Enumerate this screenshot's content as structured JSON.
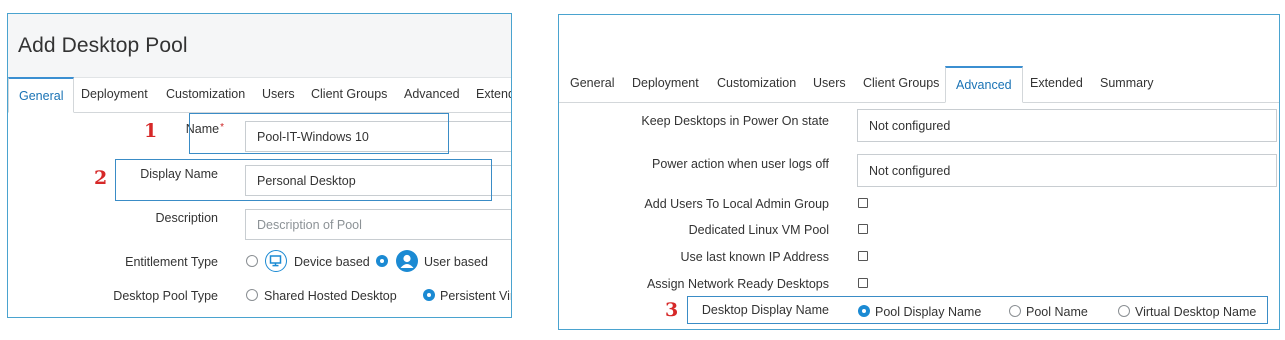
{
  "left": {
    "title": "Add Desktop Pool",
    "tabs": [
      "General",
      "Deployment",
      "Customization",
      "Users",
      "Client Groups",
      "Advanced",
      "Extend"
    ],
    "active_tab": "General",
    "name": {
      "label": "Name",
      "required_mark": "*",
      "value": "Pool-IT-Windows 10"
    },
    "display_name": {
      "label": "Display Name",
      "value": "Personal Desktop"
    },
    "description": {
      "label": "Description",
      "placeholder": "Description of Pool"
    },
    "entitlement": {
      "label": "Entitlement Type",
      "options": [
        "Device based",
        "User based"
      ],
      "selected": "User based"
    },
    "pool_type": {
      "label": "Desktop Pool Type",
      "options": [
        "Shared Hosted Desktop",
        "Persistent Virt"
      ],
      "selected": "Persistent Virt"
    }
  },
  "right": {
    "tabs": [
      "General",
      "Deployment",
      "Customization",
      "Users",
      "Client Groups",
      "Advanced",
      "Extended",
      "Summary"
    ],
    "active_tab": "Advanced",
    "keep_power_on": {
      "label": "Keep Desktops in Power On state",
      "value": "Not configured"
    },
    "power_action": {
      "label": "Power action when user logs off",
      "value": "Not configured"
    },
    "checkboxes": [
      {
        "label": "Add Users To Local Admin Group",
        "checked": false
      },
      {
        "label": "Dedicated Linux VM Pool",
        "checked": false
      },
      {
        "label": "Use last known IP Address",
        "checked": false
      },
      {
        "label": "Assign Network Ready Desktops",
        "checked": false
      }
    ],
    "display_name_choice": {
      "label": "Desktop Display Name",
      "options": [
        "Pool Display Name",
        "Pool Name",
        "Virtual Desktop Name"
      ],
      "selected": "Pool Display Name"
    }
  },
  "markers": [
    "1",
    "2",
    "3"
  ],
  "colors": {
    "accent": "#1b8ad3",
    "highlight_border": "#3a8cc6",
    "marker": "#d62828"
  },
  "icons": [
    "monitor-icon",
    "user-icon"
  ]
}
